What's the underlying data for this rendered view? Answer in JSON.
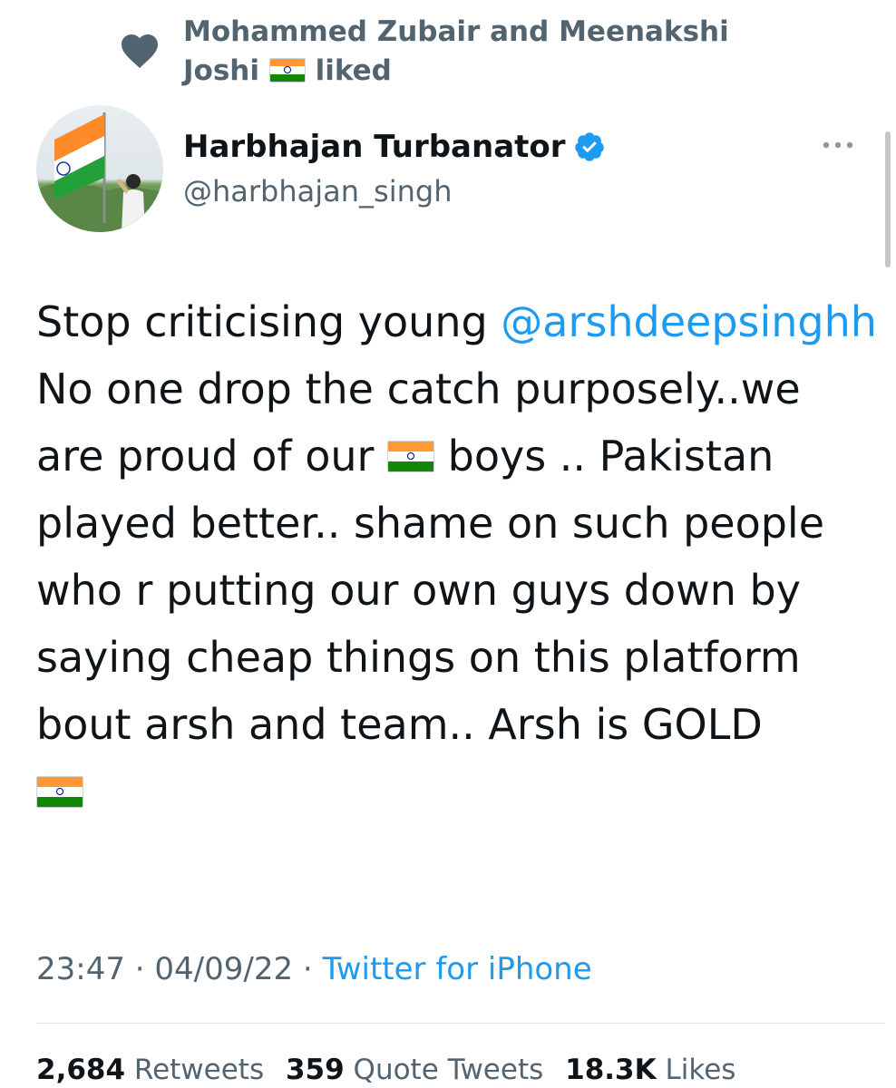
{
  "social_context": {
    "liked_by": "Mohammed Zubair and Meenakshi Joshi",
    "liked_label": "liked",
    "flag_icon": "india-flag-icon"
  },
  "author": {
    "display_name": "Harbhajan Turbanator",
    "handle": "@harbhajan_singh",
    "verified": true
  },
  "tweet": {
    "text_part1": "Stop criticising young",
    "mention": "@arshdeepsinghh",
    "text_part2": " No one drop the catch purposely..we are proud of our ",
    "text_part3": " boys .. Pakistan played better.. shame on such people who r putting our own guys down by saying cheap things on this platform bout arsh and team.. Arsh is GOLD"
  },
  "meta": {
    "time": "23:47",
    "date": "04/09/22",
    "separator": " · ",
    "source": "Twitter for iPhone"
  },
  "stats": {
    "retweets_count": "2,684",
    "retweets_label": "Retweets",
    "quotes_count": "359",
    "quotes_label": "Quote Tweets",
    "likes_count": "18.3K",
    "likes_label": "Likes"
  },
  "colors": {
    "accent": "#1d9bf0",
    "secondary_text": "#536471",
    "primary_text": "#0f1419"
  }
}
